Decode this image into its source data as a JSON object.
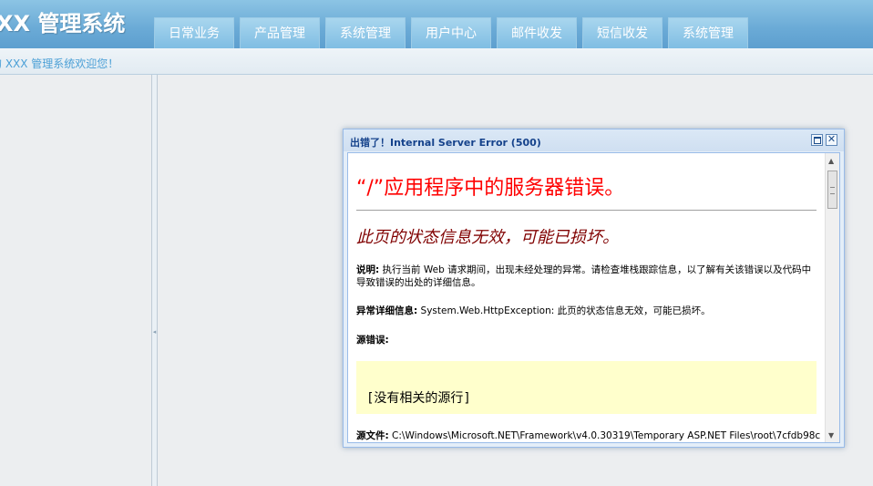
{
  "header": {
    "app_title": "XX 管理系统",
    "nav_tabs": [
      "日常业务",
      "产品管理",
      "系统管理",
      "用户中心",
      "邮件收发",
      "短信收发",
      "系统管理"
    ]
  },
  "welcome": {
    "text": "的 XXX 管理系统欢迎您！"
  },
  "dialog": {
    "title": "出错了！Internal Server Error (500)",
    "error_heading": "“/”应用程序中的服务器错误。",
    "error_subheading": "此页的状态信息无效，可能已损坏。",
    "description_label": "说明:",
    "description_text": "执行当前 Web 请求期间，出现未经处理的异常。请检查堆栈跟踪信息，以了解有关该错误以及代码中导致错误的出处的详细信息。",
    "exception_label": "异常详细信息:",
    "exception_text": "System.Web.HttpException: 此页的状态信息无效，可能已损坏。",
    "source_error_label": "源错误:",
    "source_code_text": "[没有相关的源行]",
    "source_file_label": "源文件:",
    "source_file_text": "C:\\Windows\\Microsoft.NET\\Framework\\v4.0.30319\\Temporary ASP.NET Files\\root\\7cfdb98c"
  },
  "colors": {
    "header_blue": "#6aaad6",
    "dialog_title_blue": "#15428b",
    "error_red": "#ff0000",
    "error_maroon": "#800000",
    "code_bg": "#ffffcc"
  }
}
